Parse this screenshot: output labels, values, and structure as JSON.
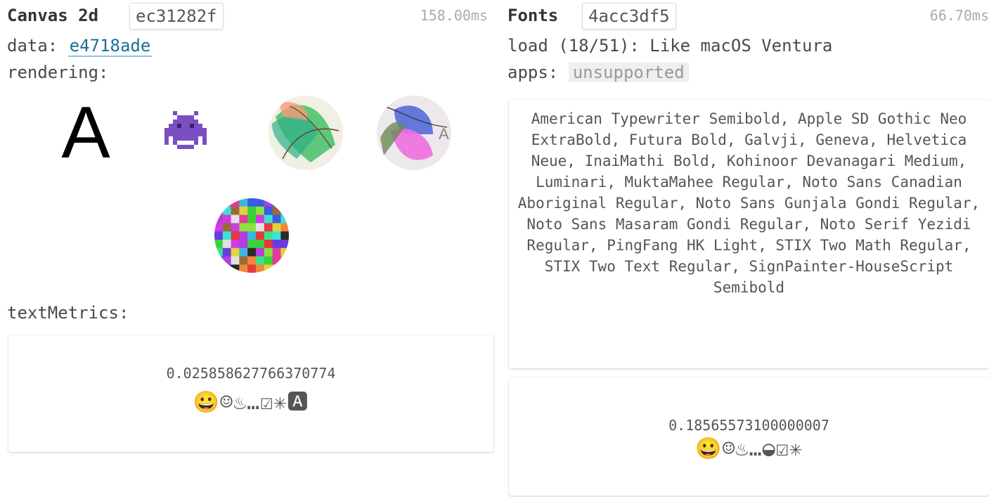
{
  "canvas": {
    "title": "Canvas 2d",
    "hash": "ec31282f",
    "time": "158.00ms",
    "data_label": "data:",
    "data_hash": "e4718ade",
    "rendering_label": "rendering:",
    "glyph": "A",
    "emoji": "👾",
    "textmetrics_label": "textMetrics:",
    "metric_value": "0.025858627766370774",
    "metric_emojis": "😀☺♨…☑✳🅰"
  },
  "fonts": {
    "title": "Fonts",
    "hash": "4acc3df5",
    "time": "66.70ms",
    "load_text": "load (18/51): Like macOS Ventura",
    "apps_label": "apps:",
    "apps_value": "unsupported",
    "font_list": "American Typewriter Semibold, Apple SD Gothic Neo ExtraBold, Futura Bold, Galvji, Geneva, Helvetica Neue, InaiMathi Bold, Kohinoor Devanagari Medium, Luminari, MuktaMahee Regular, Noto Sans Canadian Aboriginal Regular, Noto Sans Gunjala Gondi Regular, Noto Sans Masaram Gondi Regular, Noto Serif Yezidi Regular, PingFang HK Light, STIX Two Math Regular, STIX Two Text Regular, SignPainter-HouseScript Semibold",
    "metric_value": "0.18565573100000007",
    "metric_emojis": "😀☺♨…◒☑✳"
  },
  "icons": {
    "invader": "alien-invader-icon",
    "checkbox": "ballot-box-check-icon"
  }
}
